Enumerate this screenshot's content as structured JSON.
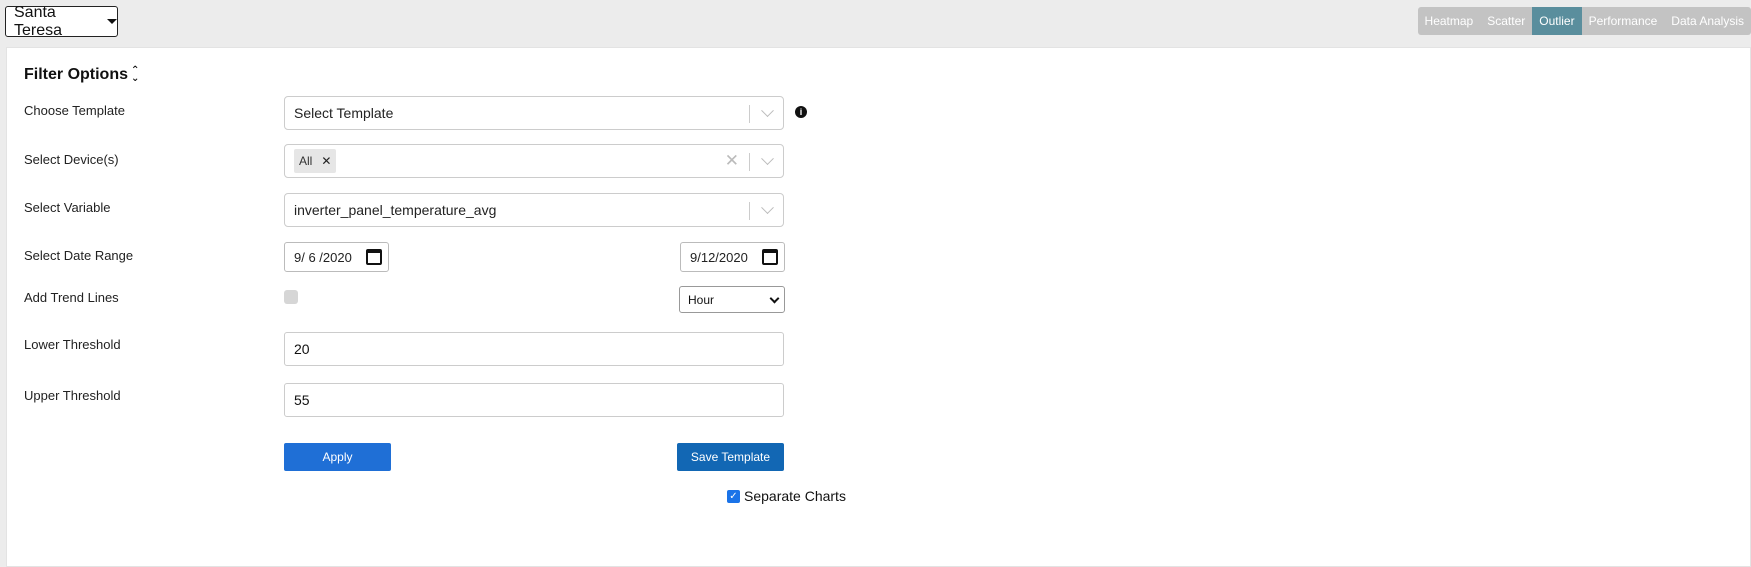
{
  "site_selector": {
    "label": "Santa Teresa"
  },
  "nav_tabs": [
    {
      "label": "Heatmap",
      "active": false
    },
    {
      "label": "Scatter",
      "active": false
    },
    {
      "label": "Outlier",
      "active": true
    },
    {
      "label": "Performance",
      "active": false
    },
    {
      "label": "Data Analysis",
      "active": false
    }
  ],
  "filter": {
    "heading": "Filter Options",
    "choose_template": {
      "label": "Choose Template",
      "value": "Select Template"
    },
    "devices": {
      "label": "Select Device(s)",
      "chip": "All"
    },
    "variable": {
      "label": "Select Variable",
      "value": "inverter_panel_temperature_avg"
    },
    "date_range": {
      "label": "Select Date Range",
      "start": "9/ 6 /2020",
      "end": "9/12/2020"
    },
    "trend_lines": {
      "label": "Add Trend Lines",
      "checked": false,
      "interval": "Hour"
    },
    "lower_threshold": {
      "label": "Lower Threshold",
      "value": "20"
    },
    "upper_threshold": {
      "label": "Upper Threshold",
      "value": "55"
    },
    "apply_label": "Apply",
    "save_template_label": "Save Template",
    "separate_charts": {
      "label": "Separate Charts",
      "checked": true
    }
  },
  "colors": {
    "active_tab": "#5a8e9d",
    "inactive_tab": "#c3c3c3",
    "apply_button": "#1f6fd6",
    "save_button": "#1267b4"
  }
}
